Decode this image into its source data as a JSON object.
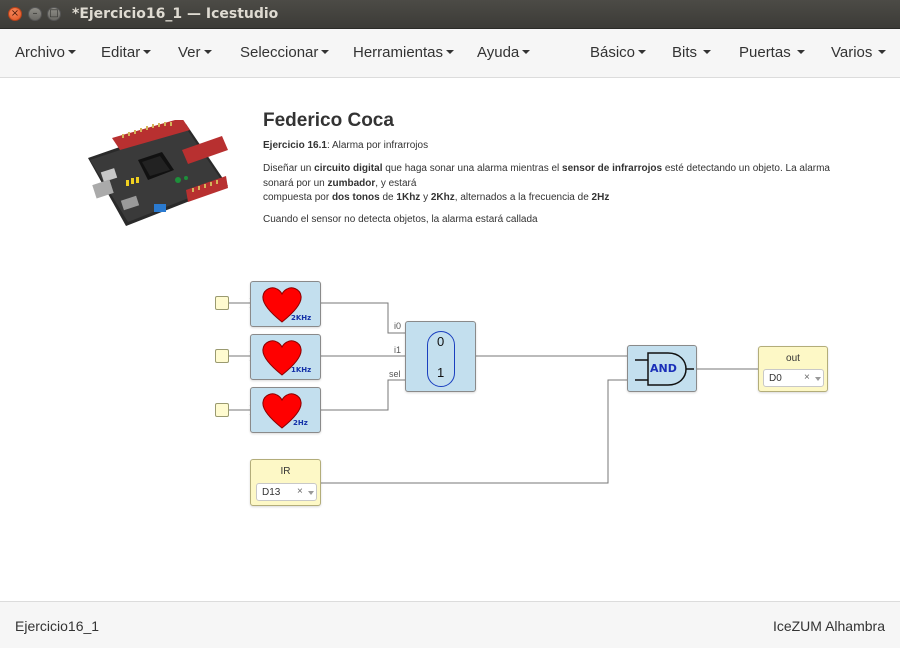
{
  "window": {
    "title": "*Ejercicio16_1 — Icestudio",
    "close_glyph": "×",
    "minimize_glyph": "–",
    "maximize_glyph": "□"
  },
  "menu": {
    "left": [
      "Archivo",
      "Editar",
      "Ver",
      "Seleccionar",
      "Herramientas",
      "Ayuda"
    ],
    "right": [
      "Básico",
      "Bits",
      "Puertas",
      "Varios"
    ]
  },
  "project_info": {
    "author": "Federico Coca",
    "exercise_label": "Ejercicio 16.1",
    "exercise_title": ": Alarma por infrarrojos",
    "desc_parts": [
      {
        "text": "Diseñar un ",
        "bold": false
      },
      {
        "text": "circuito digital",
        "bold": true
      },
      {
        "text": " que haga sonar una alarma mientras el ",
        "bold": false
      },
      {
        "text": "sensor de infrarrojos",
        "bold": true
      },
      {
        "text": " esté detectando un objeto. La alarma sonará por un ",
        "bold": false
      },
      {
        "text": "zumbador",
        "bold": true
      },
      {
        "text": ", y estará",
        "bold": false
      },
      {
        "text": "\n",
        "bold": false
      },
      {
        "text": "compuesta por ",
        "bold": false
      },
      {
        "text": "dos tonos",
        "bold": true
      },
      {
        "text": " de ",
        "bold": false
      },
      {
        "text": "1Khz",
        "bold": true
      },
      {
        "text": " y ",
        "bold": false
      },
      {
        "text": "2Khz",
        "bold": true
      },
      {
        "text": ", alternados a la frecuencia de ",
        "bold": false
      },
      {
        "text": "2Hz",
        "bold": true
      }
    ],
    "note": "Cuando el sensor no detecta objetos, la alarma estará callada"
  },
  "circuit": {
    "heart_blocks": [
      {
        "label": "2KHz"
      },
      {
        "label": "1KHz"
      },
      {
        "label": "2Hz"
      }
    ],
    "mux": {
      "ports": [
        "i0",
        "i1",
        "sel"
      ],
      "values": [
        "0",
        "1"
      ]
    },
    "and_gate": {
      "label": "AND"
    },
    "input_ir": {
      "name": "IR",
      "pin": "D13"
    },
    "output": {
      "name": "out",
      "pin": "D0"
    },
    "clear_glyph": "×"
  },
  "colors": {
    "block_blue": "#c3dfee",
    "io_yellow": "#fdf8c6",
    "heart_red": "#ff0000",
    "accent_blue": "#1a3fbf"
  },
  "status": {
    "project": "Ejercicio16_1",
    "board": "IceZUM Alhambra"
  }
}
